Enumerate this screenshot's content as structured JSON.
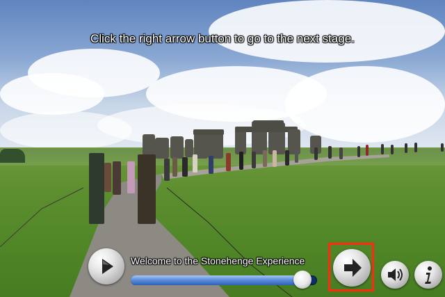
{
  "instruction": "Click the right arrow button to go to the next stage.",
  "player": {
    "stage_title": "Welcome to the Stonehenge Experience",
    "progress": 0.92,
    "highlight_color": "#ff2a0f",
    "accent_color": "#2f62b6"
  },
  "icons": {
    "play": "play-icon",
    "next": "right-arrow-icon",
    "audio": "speaker-icon",
    "info": "info-icon"
  }
}
